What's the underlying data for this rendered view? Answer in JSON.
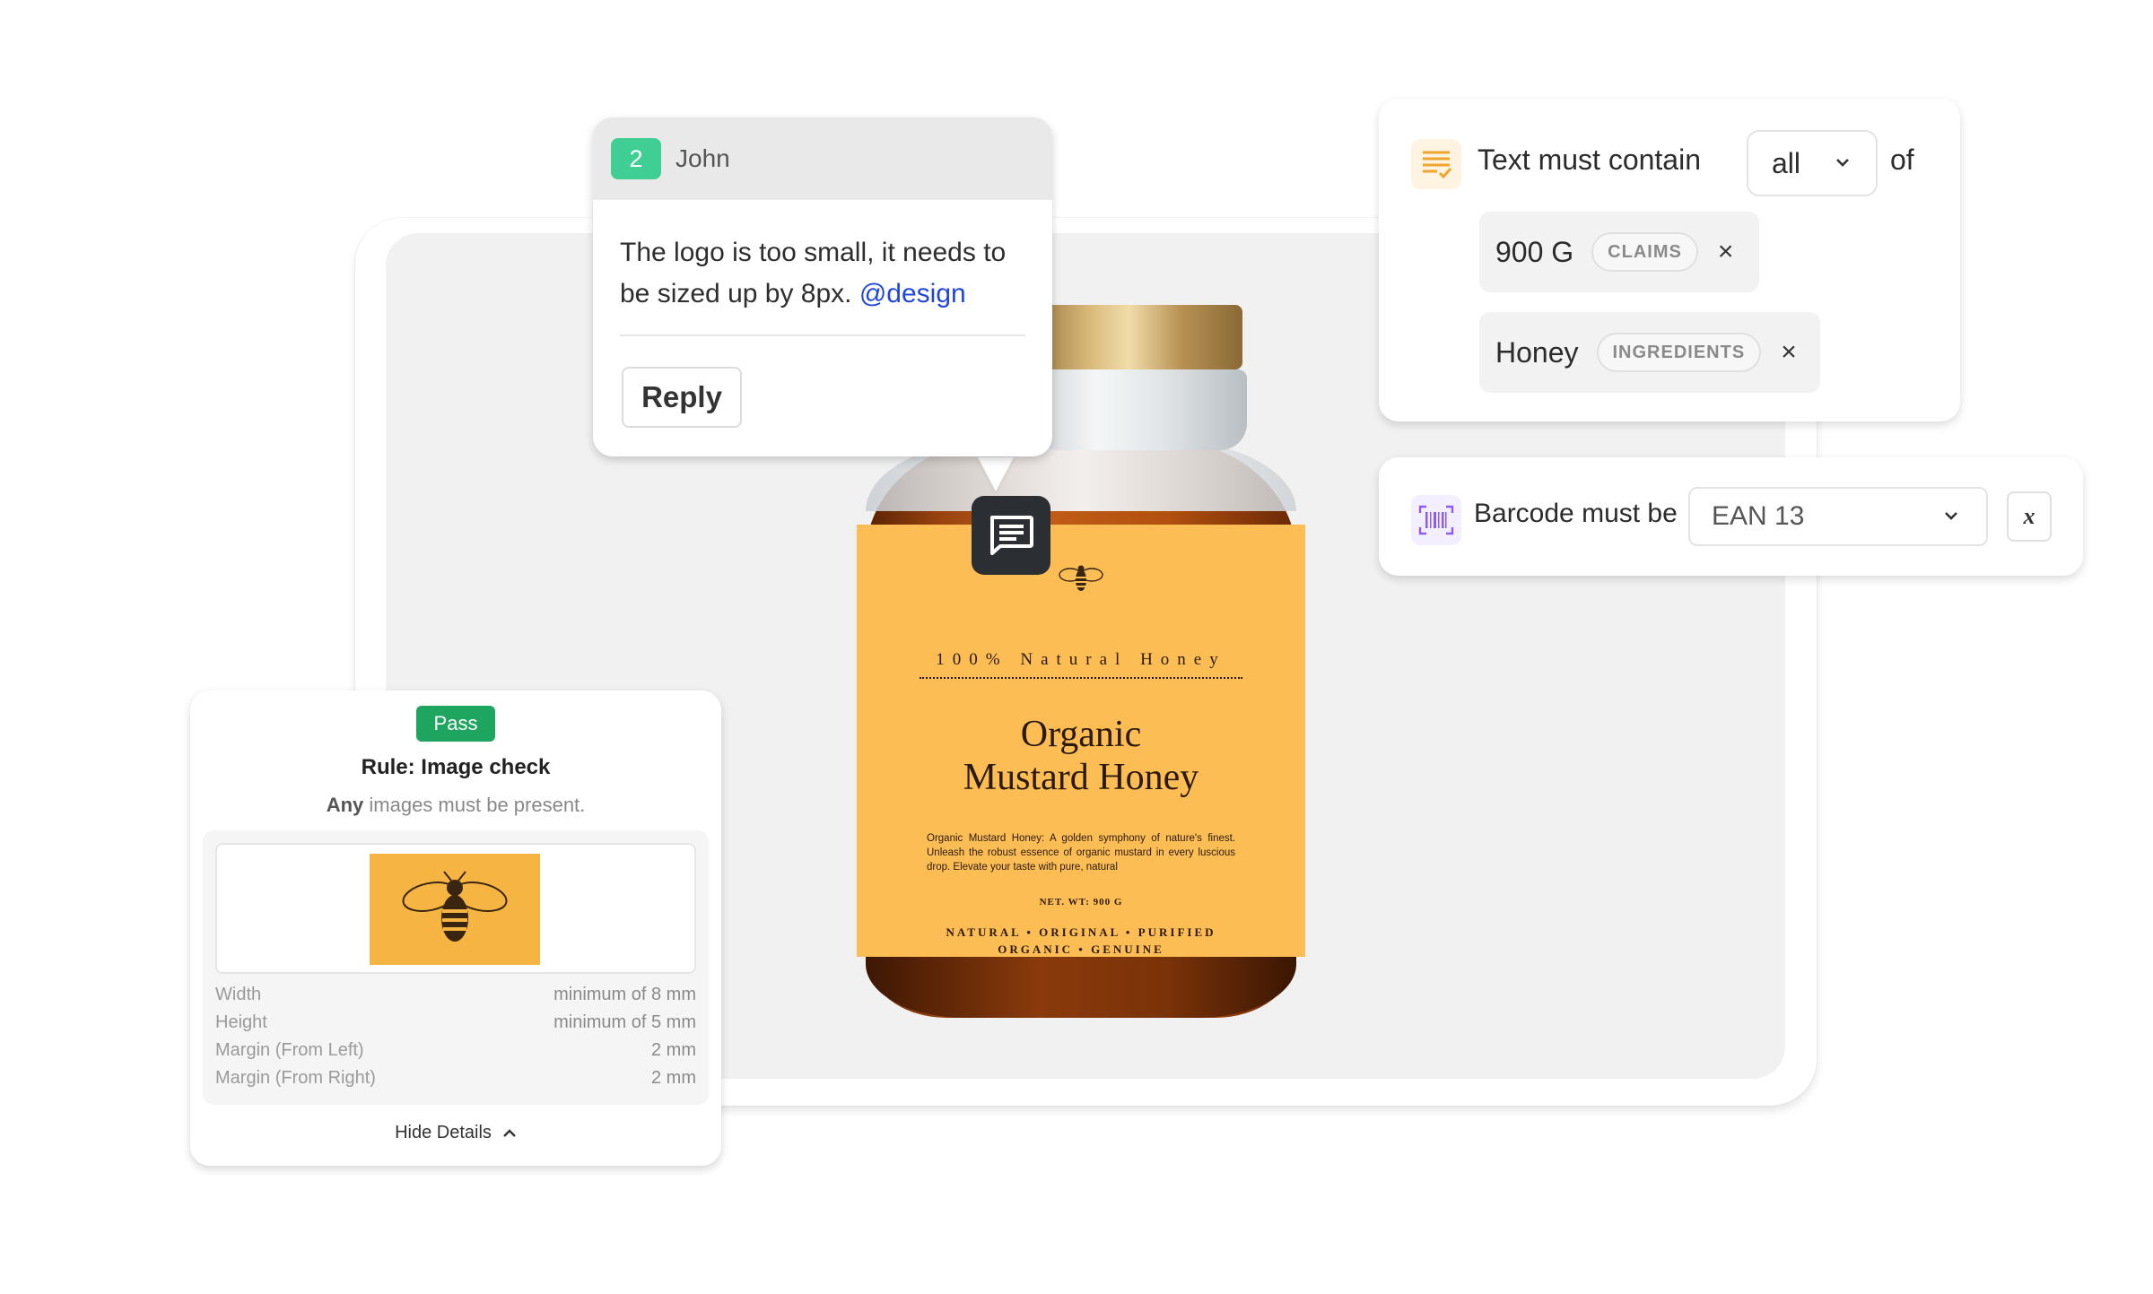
{
  "comment": {
    "number": "2",
    "user": "John",
    "text": "The logo is too small, it needs to be sized up by 8px. ",
    "mention": "@design",
    "reply_label": "Reply"
  },
  "text_rule": {
    "label": "Text must contain",
    "quantifier": "all",
    "suffix": "of",
    "items": [
      {
        "value": "900 G",
        "tag": "CLAIMS"
      },
      {
        "value": "Honey",
        "tag": "INGREDIENTS"
      }
    ]
  },
  "barcode_rule": {
    "label": "Barcode must be",
    "value": "EAN 13",
    "fx_label": "x"
  },
  "image_check": {
    "status": "Pass",
    "rule_prefix": "Rule:",
    "rule_name": "Image check",
    "any_word": "Any",
    "any_rest": "images must be present.",
    "details": [
      {
        "label": "Width",
        "value": "minimum of 8 mm"
      },
      {
        "label": "Height",
        "value": "minimum of 5 mm"
      },
      {
        "label": "Margin (From Left)",
        "value": "2 mm"
      },
      {
        "label": "Margin (From Right)",
        "value": "2 mm"
      }
    ],
    "hide_label": "Hide Details"
  },
  "product_label": {
    "tagline": "100% Natural Honey",
    "title_line1": "Organic",
    "title_line2": "Mustard Honey",
    "description": "Organic Mustard Honey: A golden symphony of nature's finest. Unleash the robust essence of organic mustard in every luscious drop. Elevate your taste with pure, natural",
    "net_weight": "NET. WT: 900 G",
    "attributes_line1": "NATURAL • ORIGINAL • PURIFIED",
    "attributes_line2": "ORGANIC • GENUINE"
  },
  "colors": {
    "pass": "#1ea560",
    "comment_badge": "#3fcf94",
    "mention": "#2147d8",
    "label": "#fdbd55"
  },
  "icons": {
    "text_rule": "text-lines-icon",
    "barcode_rule": "barcode-icon",
    "pin": "comment-icon"
  }
}
